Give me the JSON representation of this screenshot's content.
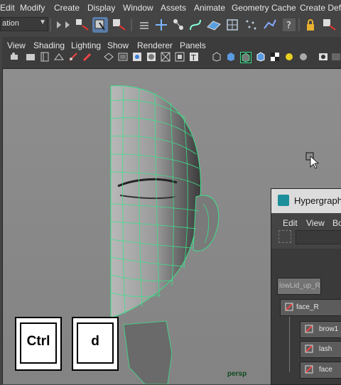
{
  "menubar": {
    "items": [
      "Edit",
      "Modify",
      "Create",
      "Display",
      "Window",
      "Assets",
      "Animate",
      "Geometry Cache",
      "Create Defo"
    ]
  },
  "toolbar": {
    "mode_dropdown": "ation"
  },
  "panel": {
    "menu": [
      "View",
      "Shading",
      "Lighting",
      "Show",
      "Renderer",
      "Panels"
    ]
  },
  "viewport": {
    "camera_label": "persp",
    "background_color": "#8a8a8a",
    "wireframe_color": "#3ce08a"
  },
  "overlay_keys": [
    "Ctrl",
    "d"
  ],
  "hypergraph": {
    "title": "Hypergraph",
    "menu": [
      "Edit",
      "View",
      "Bo"
    ],
    "partial_node": "lowLid_up_R",
    "nodes": [
      {
        "label": "face_R"
      },
      {
        "label": "brow1"
      },
      {
        "label": "lash"
      },
      {
        "label": "face"
      }
    ]
  }
}
